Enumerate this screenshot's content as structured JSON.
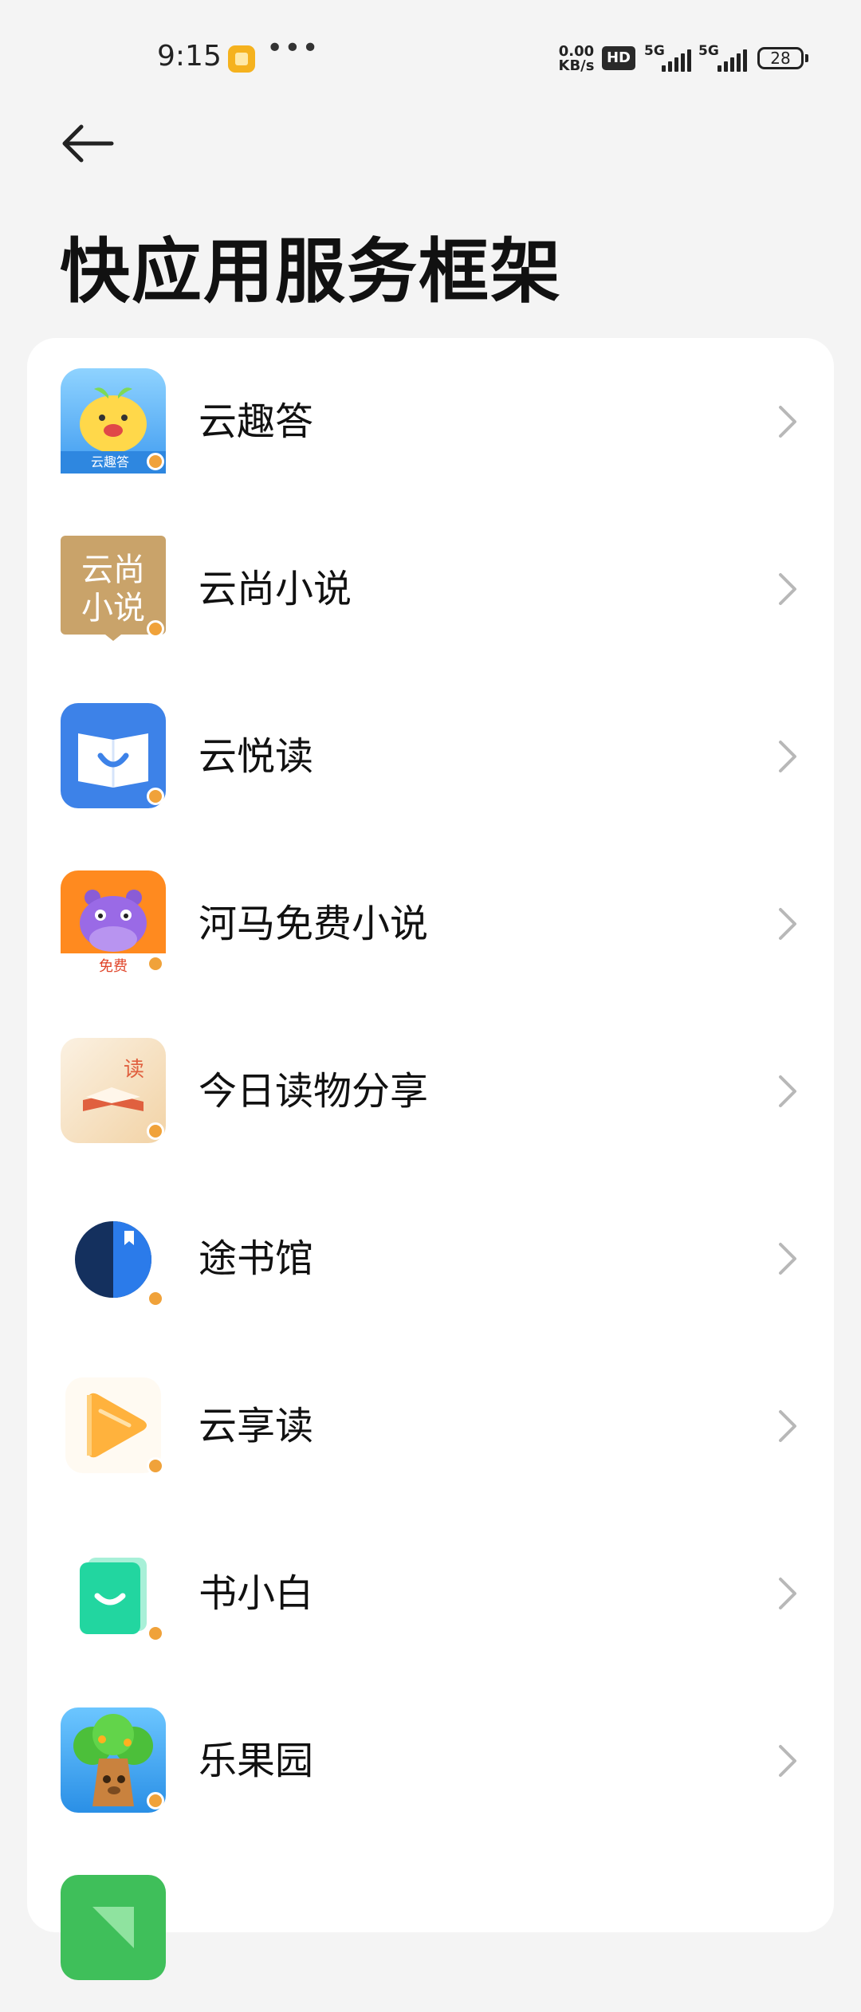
{
  "status_bar": {
    "time": "9:15",
    "notification_icon": "app-notification-icon",
    "overflow": "•••",
    "speed_value": "0.00",
    "speed_unit": "KB/s",
    "hd_label": "HD",
    "network1": "5G",
    "network2": "5G",
    "battery": "28"
  },
  "header": {
    "back_icon": "back-arrow-icon",
    "title": "快应用服务框架"
  },
  "apps": [
    {
      "name": "云趣答",
      "icon": "yunqueda-icon"
    },
    {
      "name": "云尚小说",
      "icon": "yunshang-novel-icon"
    },
    {
      "name": "云悦读",
      "icon": "yunyuedu-icon"
    },
    {
      "name": "河马免费小说",
      "icon": "hema-novel-icon"
    },
    {
      "name": "今日读物分享",
      "icon": "jinri-reading-icon"
    },
    {
      "name": "途书馆",
      "icon": "tushuguan-icon"
    },
    {
      "name": "云享读",
      "icon": "yunxiangdu-icon"
    },
    {
      "name": "书小白",
      "icon": "shuxiaobai-icon"
    },
    {
      "name": "乐果园",
      "icon": "leguoyuan-icon"
    },
    {
      "name": "",
      "icon": "partial-green-app-icon"
    }
  ],
  "icon_text": {
    "yunqueda": "云趣答",
    "yunshang_line1": "云尚",
    "yunshang_line2": "小说",
    "hema": "免费",
    "jinri": "读"
  },
  "colors": {
    "background": "#f4f4f4",
    "card": "#ffffff",
    "chevron": "#b8b8b8",
    "link_badge": "#f0a23a"
  }
}
